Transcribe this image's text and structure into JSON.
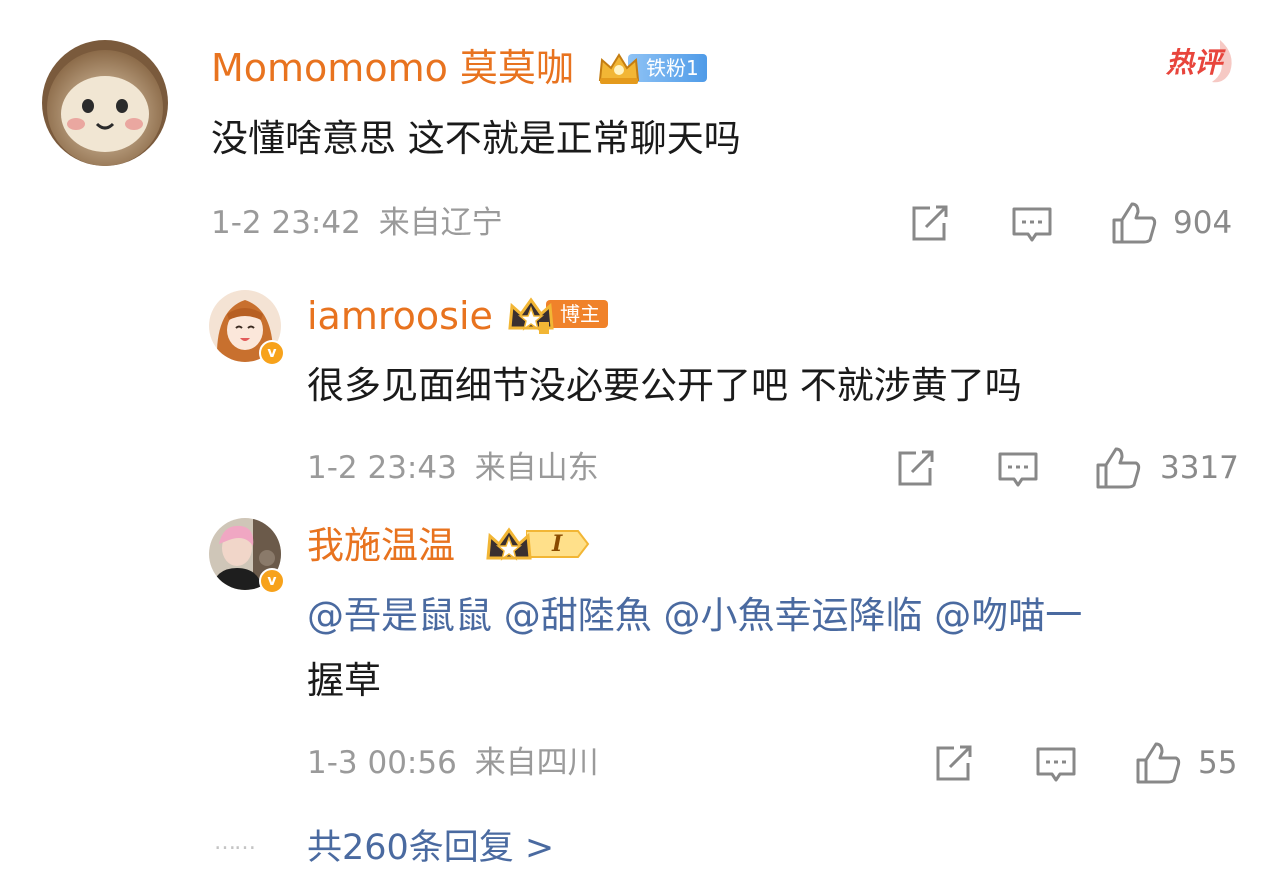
{
  "colors": {
    "username": "#e8731f",
    "mention": "#4a6aa0",
    "meta": "#9a9a9a",
    "hot_badge": "#e8453c",
    "verified": "#f7a21b"
  },
  "comments": [
    {
      "username": "Momomomo 莫莫咖",
      "badge_label": "铁粉1",
      "badge_icon": "fans-crown-icon",
      "hot_label": "热评",
      "text": "没懂啥意思 这不就是正常聊天吗",
      "time": "1-2 23:42",
      "location": "来自辽宁",
      "like_count": "904"
    },
    {
      "username": "iamroosie",
      "badge_label": "博主",
      "badge_icon": "crown-icon",
      "verified": true,
      "text": "很多见面细节没必要公开了吧 不就涉黄了吗",
      "time": "1-2 23:43",
      "location": "来自山东",
      "like_count": "3317"
    },
    {
      "username": "我施温温",
      "badge_label": "I",
      "badge_icon": "crown-icon",
      "verified": true,
      "mentions": [
        "@吾是鼠鼠",
        "@甜陸魚",
        "@小魚幸运降临",
        "@吻喵一"
      ],
      "text_line2": "握草",
      "time": "1-3 00:56",
      "location": "来自四川",
      "like_count": "55"
    }
  ],
  "footer": {
    "dots": "……",
    "reply_summary": "共260条回复 >"
  }
}
